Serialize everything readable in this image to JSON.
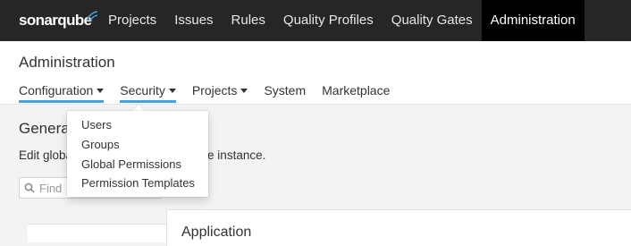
{
  "topbar": {
    "logo_text": "sonarqube",
    "items": [
      {
        "label": "Projects"
      },
      {
        "label": "Issues"
      },
      {
        "label": "Rules"
      },
      {
        "label": "Quality Profiles"
      },
      {
        "label": "Quality Gates"
      },
      {
        "label": "Administration",
        "active": true
      }
    ]
  },
  "admin": {
    "title": "Administration",
    "subnav": [
      {
        "label": "Configuration",
        "has_caret": true,
        "underlined": true
      },
      {
        "label": "Security",
        "has_caret": true,
        "underlined": true
      },
      {
        "label": "Projects",
        "has_caret": true
      },
      {
        "label": "System"
      },
      {
        "label": "Marketplace"
      }
    ]
  },
  "security_menu": {
    "items": [
      {
        "label": "Users"
      },
      {
        "label": "Groups"
      },
      {
        "label": "Global Permissions"
      },
      {
        "label": "Permission Templates"
      }
    ]
  },
  "main": {
    "title": "General Settings",
    "title_visible": "Genera",
    "description_left": "Edit globa",
    "description_right": "e instance.",
    "search": {
      "placeholder": "Find",
      "icon": "search-icon"
    },
    "panel_heading": "Application"
  },
  "colors": {
    "topbar_bg": "#262626",
    "active_nav_bg": "#000000",
    "underline_accent": "#4b9fd5",
    "page_bg": "#f3f3f3"
  }
}
